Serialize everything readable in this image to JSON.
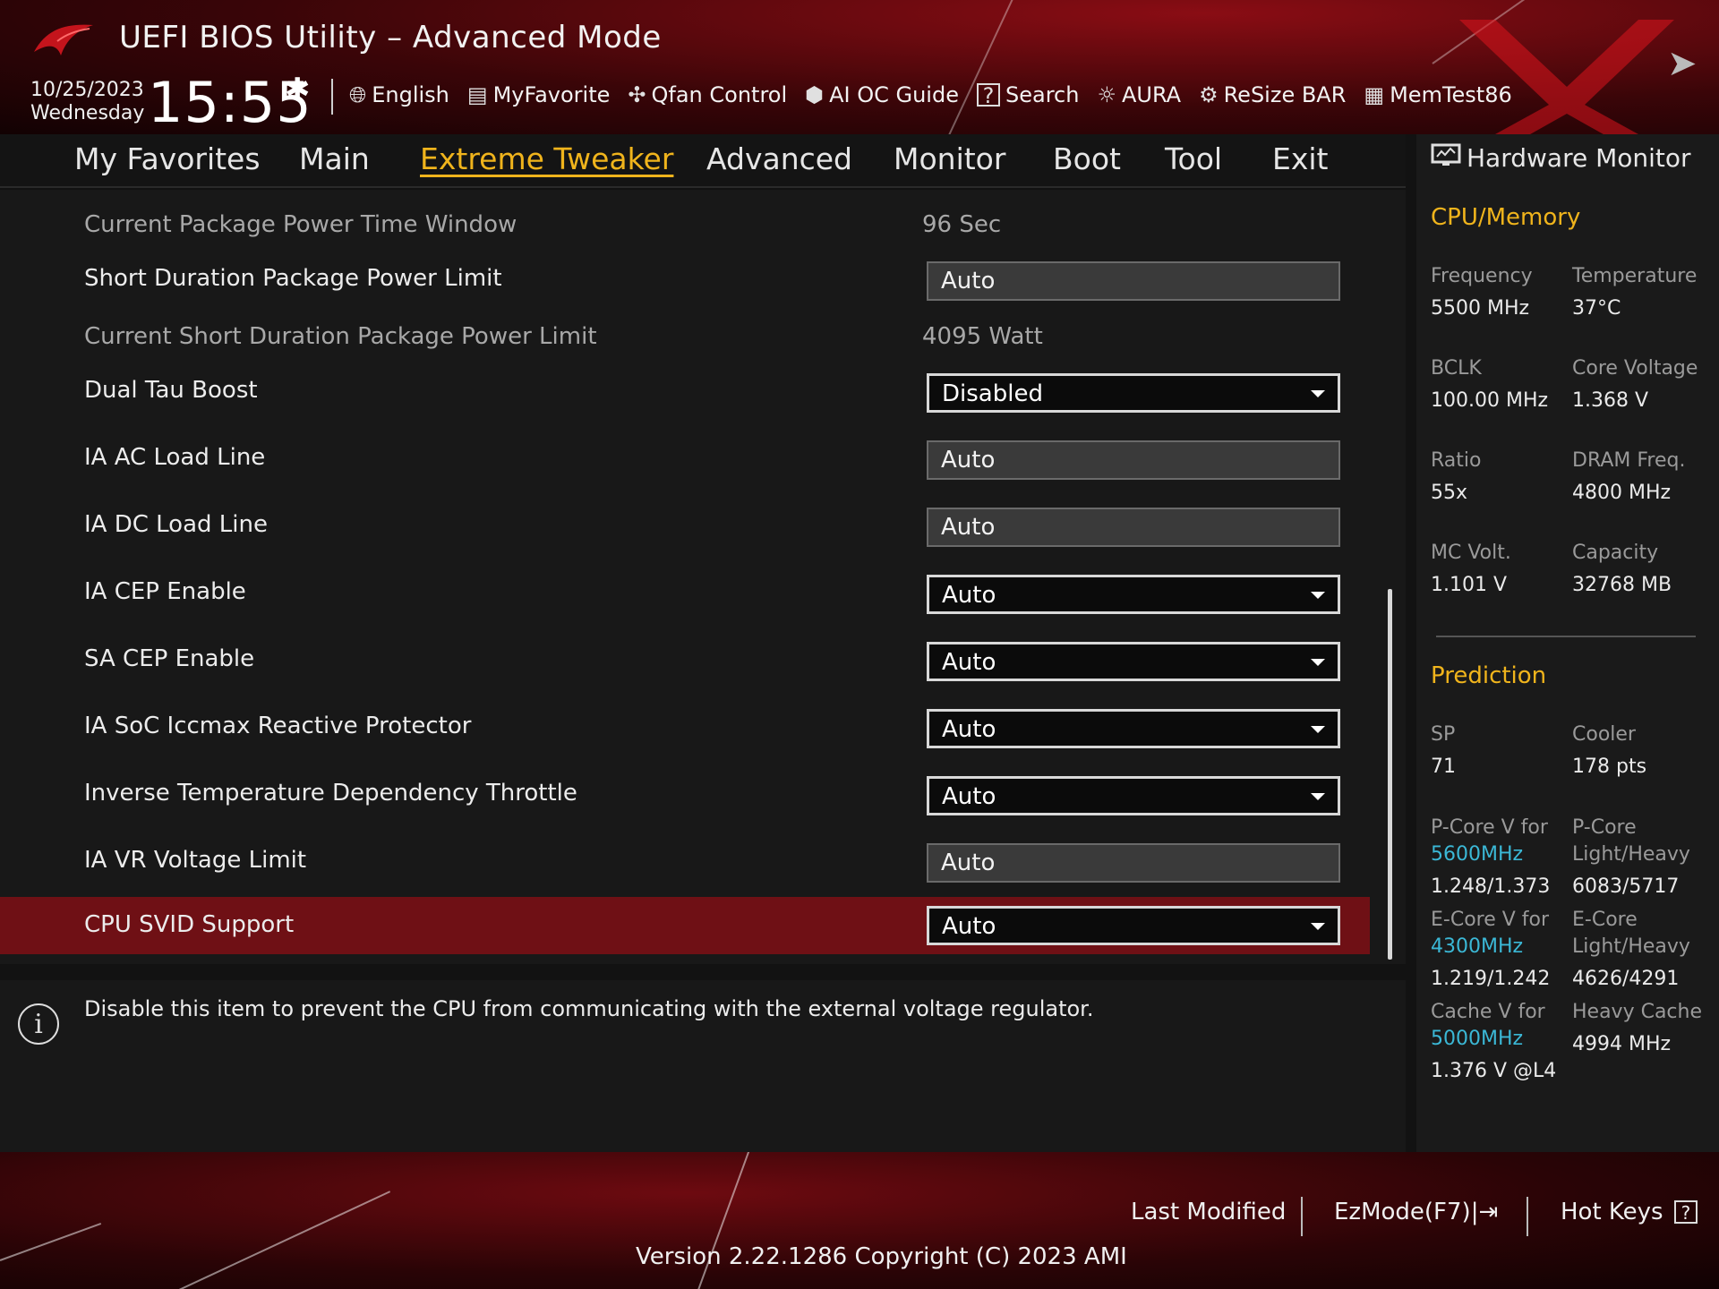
{
  "app": {
    "title": "UEFI BIOS Utility – Advanced Mode",
    "date": "10/25/2023",
    "weekday": "Wednesday",
    "time": "15:55"
  },
  "toolbar": [
    {
      "label": "English",
      "icon": "globe-icon"
    },
    {
      "label": "MyFavorite",
      "icon": "favorite-icon"
    },
    {
      "label": "Qfan Control",
      "icon": "fan-icon"
    },
    {
      "label": "AI OC Guide",
      "icon": "ai-oc-guide-icon"
    },
    {
      "label": "Search",
      "icon": "search-icon"
    },
    {
      "label": "AURA",
      "icon": "aura-icon"
    },
    {
      "label": "ReSize BAR",
      "icon": "resize-bar-icon"
    },
    {
      "label": "MemTest86",
      "icon": "memtest-icon"
    }
  ],
  "tabs": [
    {
      "label": "My Favorites"
    },
    {
      "label": "Main"
    },
    {
      "label": "Extreme Tweaker",
      "active": true
    },
    {
      "label": "Advanced"
    },
    {
      "label": "Monitor"
    },
    {
      "label": "Boot"
    },
    {
      "label": "Tool"
    },
    {
      "label": "Exit"
    }
  ],
  "settings": [
    {
      "label": "Current Package Power Time Window",
      "value": "96 Sec",
      "kind": "info"
    },
    {
      "label": "Short Duration Package Power Limit",
      "value": "Auto",
      "kind": "text"
    },
    {
      "label": "Current Short Duration Package Power Limit",
      "value": "4095 Watt",
      "kind": "info"
    },
    {
      "label": "Dual Tau Boost",
      "value": "Disabled",
      "kind": "select"
    },
    {
      "label": "IA AC Load Line",
      "value": "Auto",
      "kind": "text"
    },
    {
      "label": "IA DC Load Line",
      "value": "Auto",
      "kind": "text"
    },
    {
      "label": "IA CEP Enable",
      "value": "Auto",
      "kind": "select"
    },
    {
      "label": "SA CEP Enable",
      "value": "Auto",
      "kind": "select"
    },
    {
      "label": "IA SoC Iccmax Reactive Protector",
      "value": "Auto",
      "kind": "select"
    },
    {
      "label": "Inverse Temperature Dependency Throttle",
      "value": "Auto",
      "kind": "select"
    },
    {
      "label": "IA VR Voltage Limit",
      "value": "Auto",
      "kind": "text"
    },
    {
      "label": "CPU SVID Support",
      "value": "Auto",
      "kind": "select",
      "selected": true
    }
  ],
  "help": {
    "text": "Disable this item to prevent the CPU from communicating with the external voltage regulator."
  },
  "hardware_monitor": {
    "title": "Hardware Monitor",
    "cpu_memory": {
      "heading": "CPU/Memory",
      "frequency_label": "Frequency",
      "frequency": "5500 MHz",
      "temperature_label": "Temperature",
      "temperature": "37°C",
      "bclk_label": "BCLK",
      "bclk": "100.00 MHz",
      "core_voltage_label": "Core Voltage",
      "core_voltage": "1.368 V",
      "ratio_label": "Ratio",
      "ratio": "55x",
      "dram_freq_label": "DRAM Freq.",
      "dram_freq": "4800 MHz",
      "mc_volt_label": "MC Volt.",
      "mc_volt": "1.101 V",
      "capacity_label": "Capacity",
      "capacity": "32768 MB"
    },
    "prediction": {
      "heading": "Prediction",
      "sp_label": "SP",
      "sp": "71",
      "cooler_label": "Cooler",
      "cooler": "178 pts",
      "pcore_v_label": "P-Core V for",
      "pcore_v_freq": "5600MHz",
      "pcore_v": "1.248/1.373",
      "pcore_lh_label1": "P-Core",
      "pcore_lh_label2": "Light/Heavy",
      "pcore_lh": "6083/5717",
      "ecore_v_label": "E-Core V for",
      "ecore_v_freq": "4300MHz",
      "ecore_v": "1.219/1.242",
      "ecore_lh_label1": "E-Core",
      "ecore_lh_label2": "Light/Heavy",
      "ecore_lh": "4626/4291",
      "cache_v_label": "Cache V for",
      "cache_v_freq": "5000MHz",
      "cache_v": "1.376 V @L4",
      "heavy_cache_label": "Heavy Cache",
      "heavy_cache": "4994 MHz"
    }
  },
  "footer": {
    "last_modified": "Last Modified",
    "ezmode": "EzMode(F7)|",
    "hotkeys": "Hot Keys",
    "version": "Version 2.22.1286 Copyright (C) 2023 AMI"
  },
  "colors": {
    "accent": "#f0b41c",
    "selected_row": "#6f1015",
    "header_red": "#8a0d14",
    "cyan": "#3bb8d6"
  }
}
